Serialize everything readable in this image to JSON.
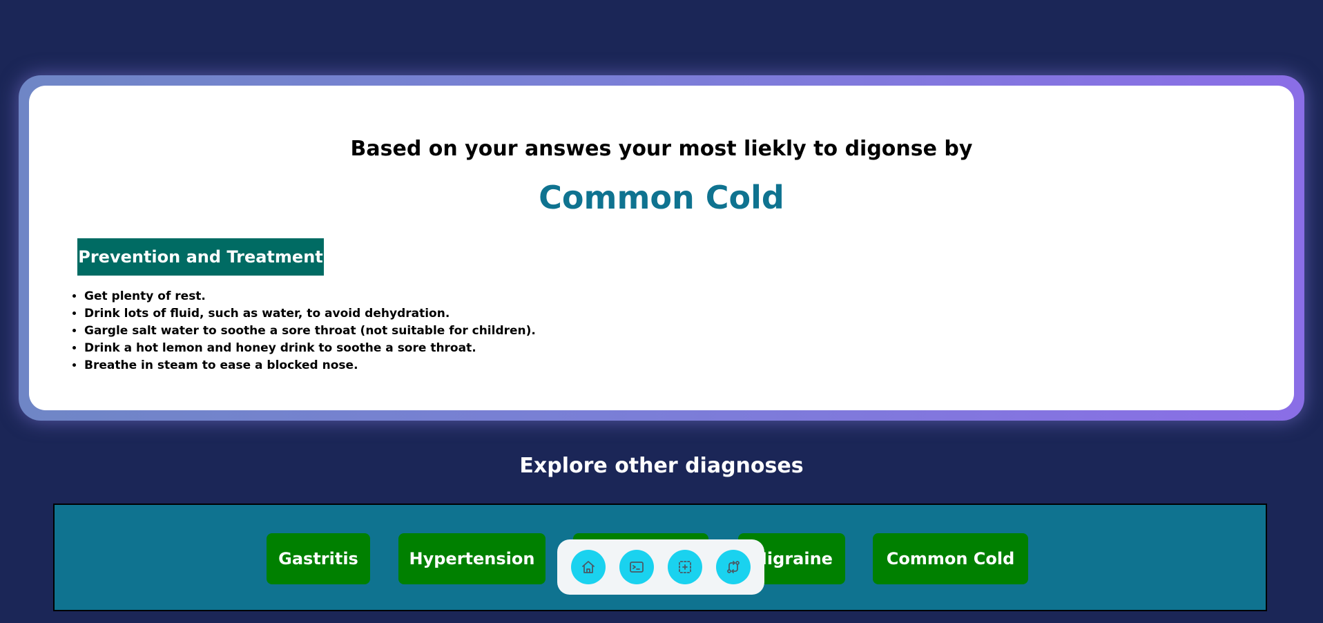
{
  "result": {
    "intro": "Based on your answes your most liekly to digonse by",
    "diagnosis": "Common Cold",
    "section_title": "Prevention and Treatment",
    "tips": [
      "Get plenty of rest.",
      "Drink lots of fluid, such as water, to avoid dehydration.",
      "Gargle salt water to soothe a sore throat (not suitable for children).",
      "Drink a hot lemon and honey drink to soothe a sore throat.",
      "Breathe in steam to ease a blocked nose."
    ]
  },
  "explore": {
    "heading": "Explore other diagnoses",
    "items": [
      "Gastritis",
      "Hypertension",
      "Migraine",
      "Common Cold"
    ]
  },
  "dock": {
    "icons": [
      "home-icon",
      "terminal-icon",
      "select-icon",
      "swap-icon"
    ]
  },
  "colors": {
    "background": "#1b2657",
    "diagnosis": "#0f7390",
    "section": "#006b63",
    "pill": "#008000",
    "dock_button": "#1ad2ef"
  }
}
